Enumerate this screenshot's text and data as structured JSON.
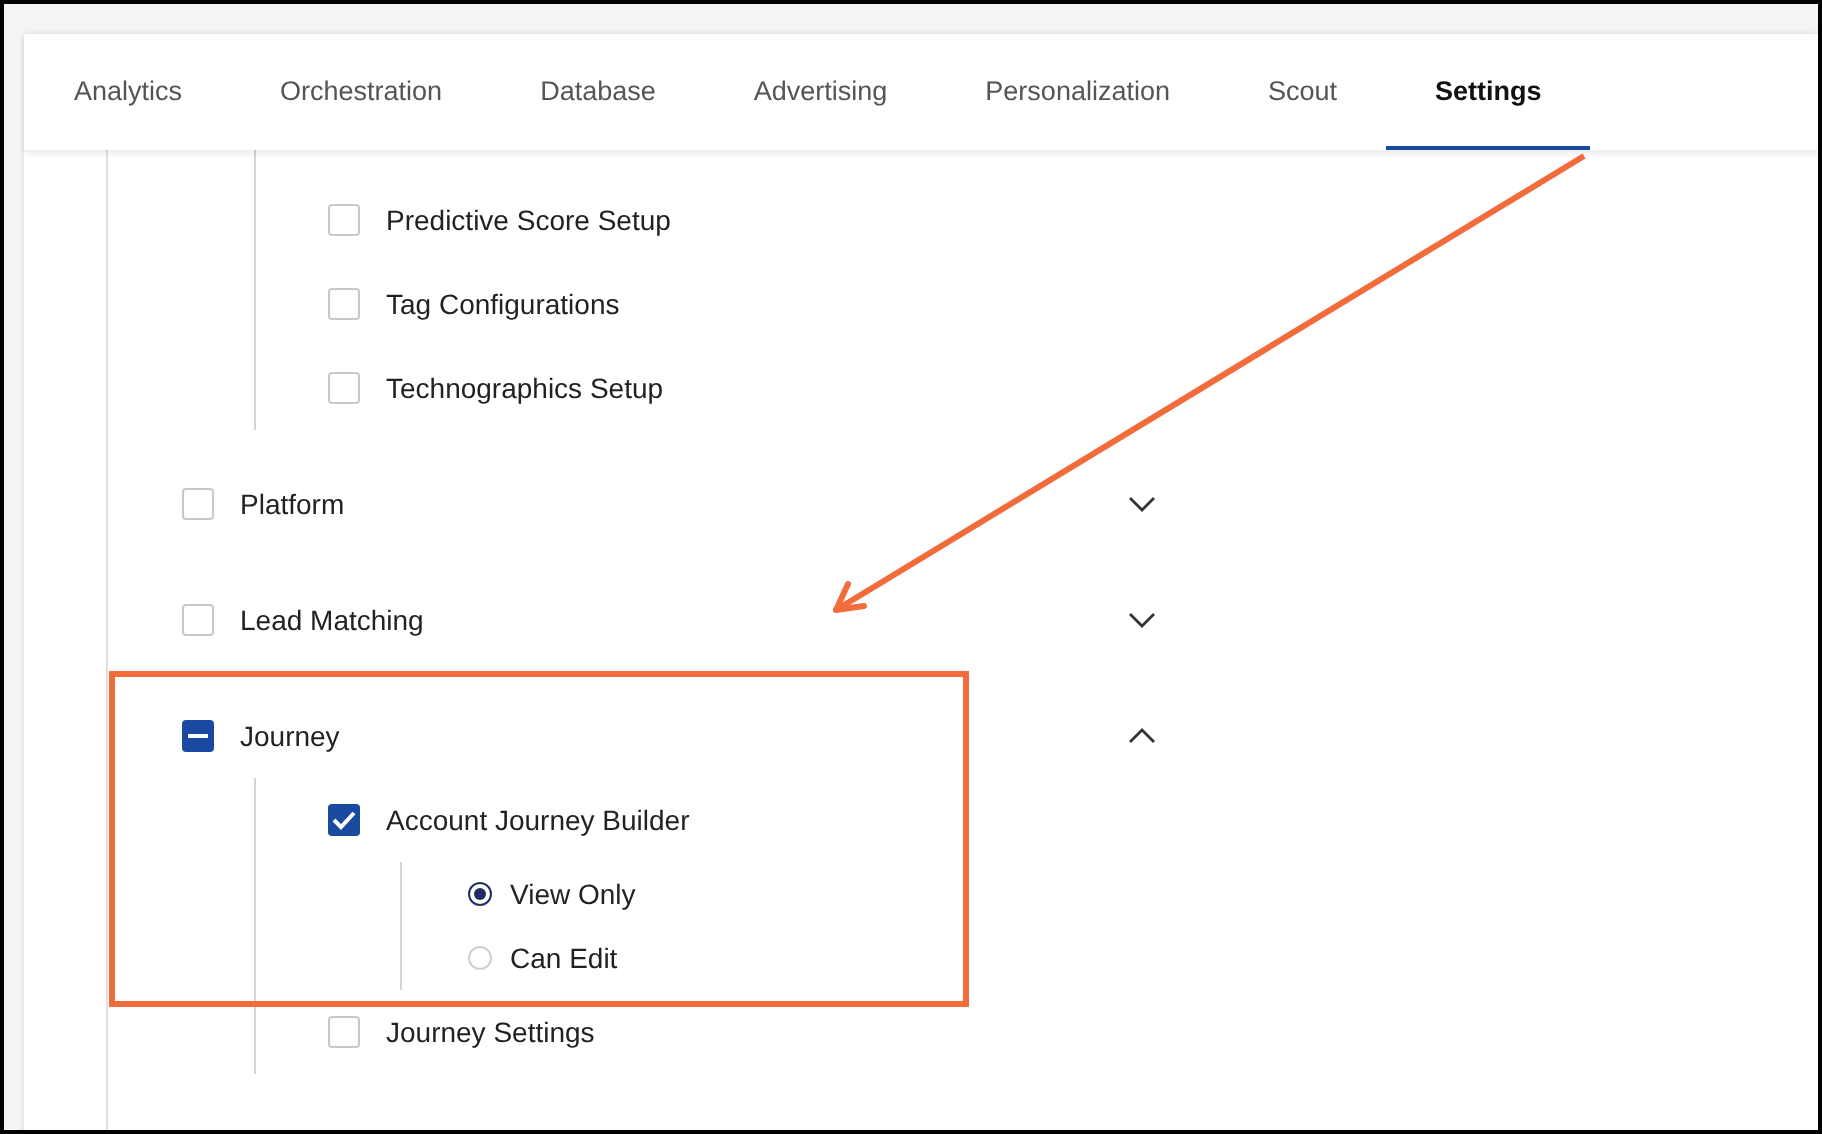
{
  "tabs": [
    {
      "label": "Analytics",
      "selected": false
    },
    {
      "label": "Orchestration",
      "selected": false
    },
    {
      "label": "Database",
      "selected": false
    },
    {
      "label": "Advertising",
      "selected": false
    },
    {
      "label": "Personalization",
      "selected": false
    },
    {
      "label": "Scout",
      "selected": false
    },
    {
      "label": "Settings",
      "selected": true
    }
  ],
  "continued_children": [
    {
      "label": "Predictive Score Setup",
      "checked": false
    },
    {
      "label": "Tag Configurations",
      "checked": false
    },
    {
      "label": "Technographics Setup",
      "checked": false
    }
  ],
  "items": [
    {
      "label": "Platform",
      "checked": false,
      "indeterminate": false,
      "expanded": false
    },
    {
      "label": "Lead Matching",
      "checked": false,
      "indeterminate": false,
      "expanded": false
    },
    {
      "label": "Journey",
      "checked": false,
      "indeterminate": true,
      "expanded": true,
      "children": [
        {
          "label": "Account Journey Builder",
          "checked": true,
          "options": [
            {
              "label": "View Only",
              "selected": true
            },
            {
              "label": "Can Edit",
              "selected": false
            }
          ]
        },
        {
          "label": "Journey Settings",
          "checked": false
        }
      ]
    }
  ]
}
